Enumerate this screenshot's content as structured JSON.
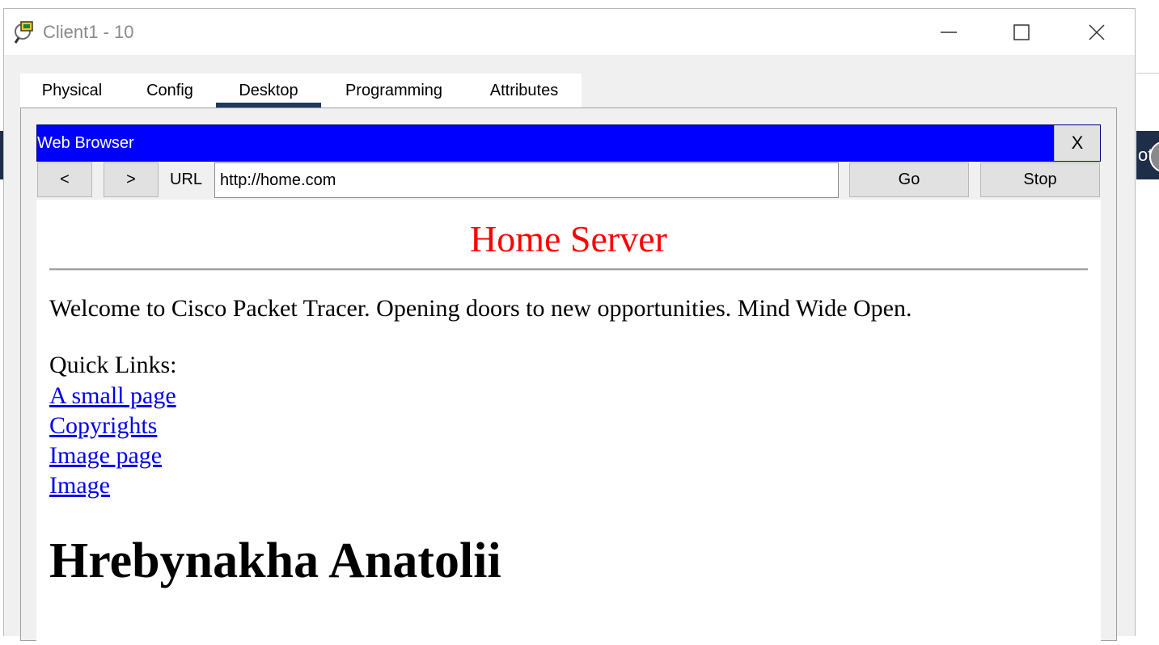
{
  "window": {
    "title": "Client1 - 10"
  },
  "tabs": [
    {
      "label": "Physical"
    },
    {
      "label": "Config"
    },
    {
      "label": "Desktop",
      "active": true
    },
    {
      "label": "Programming"
    },
    {
      "label": "Attributes"
    }
  ],
  "browser": {
    "title": "Web Browser",
    "close_label": "X",
    "back_label": "<",
    "forward_label": ">",
    "url_label": "URL",
    "url_value": "http://home.com",
    "go_label": "Go",
    "stop_label": "Stop"
  },
  "page": {
    "title": "Home Server",
    "welcome": "Welcome to Cisco Packet Tracer. Opening doors to new opportunities. Mind Wide Open.",
    "quick_links_label": "Quick Links:",
    "links": [
      "A small page",
      "Copyrights",
      "Image page",
      "Image"
    ],
    "heading": "Hrebynakha Anatolii"
  },
  "background": {
    "partial_text": "ot"
  },
  "colors": {
    "browser_header": "#0000ff",
    "page_title": "#ff0000",
    "link": "#0000ee",
    "active_tab_underline": "#1e3a5a"
  }
}
